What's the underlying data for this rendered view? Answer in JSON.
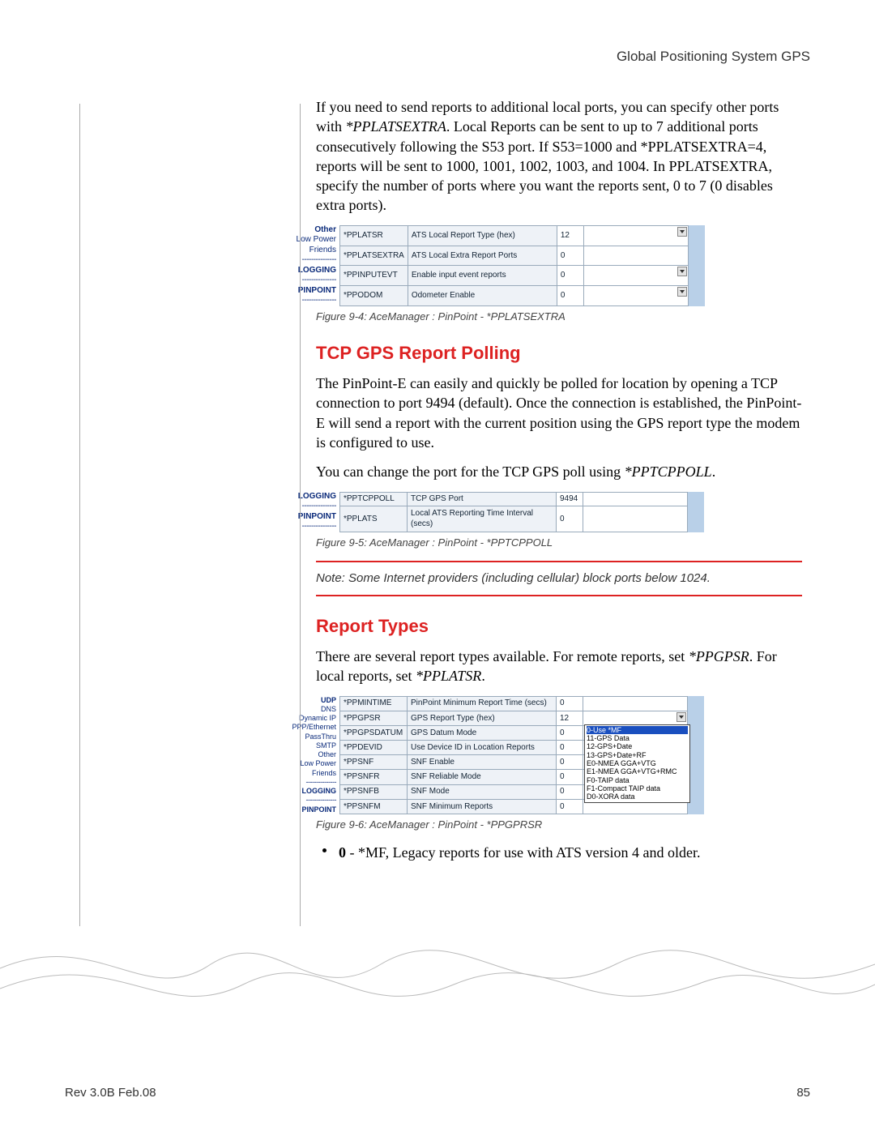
{
  "header": {
    "title": "Global Positioning System GPS"
  },
  "intro": {
    "p1_a": "If you need to send reports to additional local ports, you can specify other ports with ",
    "p1_cmd": "*PPLATSEXTRA",
    "p1_b": ". Local Reports can be sent to up to 7 additional ports consecutively following the S53 port.   If S53=1000 and *PPLATSEXTRA=4, reports will be sent to 1000, 1001, 1002, 1003, and 1004. In PPLATSEXTRA, specify the number of ports where you want the reports sent, 0 to 7 (0 disables extra ports)."
  },
  "fig1": {
    "sidebar": [
      "Other",
      "Low Power",
      "Friends",
      "---------------",
      "LOGGING",
      "---------------",
      "PINPOINT",
      "---------------"
    ],
    "sidebar_bold": {
      "0": true,
      "4": true,
      "6": true
    },
    "rows": [
      {
        "key": "*PPLATSR",
        "desc": "ATS Local Report Type (hex)",
        "val": "12",
        "dd": true
      },
      {
        "key": "*PPLATSEXTRA",
        "desc": "ATS Local Extra Report Ports",
        "val": "0",
        "dd": false
      },
      {
        "key": "*PPINPUTEVT",
        "desc": "Enable input event reports",
        "val": "0",
        "dd": true
      },
      {
        "key": "*PPODOM",
        "desc": "Odometer Enable",
        "val": "0",
        "dd": true
      }
    ],
    "caption": "Figure 9-4: AceManager : PinPoint - *PPLATSEXTRA"
  },
  "section1": {
    "title": "TCP GPS Report Polling",
    "p1": "The PinPoint-E can easily and quickly be polled for location by opening a TCP connection to port 9494 (default). Once the connection is established, the PinPoint-E will send a report with the current position using the GPS report type the modem is configured to use.",
    "p2_a": "You can change the port for the TCP GPS poll using ",
    "p2_cmd": "*PPTCPPOLL",
    "p2_b": "."
  },
  "fig2": {
    "sidebar": [
      "LOGGING",
      "---------------",
      "PINPOINT",
      "---------------"
    ],
    "sidebar_bold": {
      "0": true,
      "2": true
    },
    "rows": [
      {
        "key": "*PPTCPPOLL",
        "desc": "TCP GPS Port",
        "val": "9494",
        "dd": false
      },
      {
        "key": "*PPLATS",
        "desc": "Local ATS Reporting Time Interval (secs)",
        "val": "0",
        "dd": false
      }
    ],
    "caption": "Figure 9-5: AceManager : PinPoint - *PPTCPPOLL"
  },
  "note": "Note:  Some Internet providers (including cellular) block ports below 1024.",
  "section2": {
    "title": "Report Types",
    "p1_a": "There are several report types available. For remote reports, set ",
    "p1_cmd1": "*PPGPSR",
    "p1_b": ". For local reports, set ",
    "p1_cmd2": "*PPLATSR",
    "p1_c": "."
  },
  "fig3": {
    "sidebar": [
      "UDP",
      "DNS",
      "Dynamic IP",
      "PPP/Ethernet",
      "PassThru",
      "SMTP",
      "Other",
      "Low Power",
      "Friends",
      "---------------",
      "LOGGING",
      "---------------",
      "PINPOINT"
    ],
    "sidebar_bold": {
      "0": true,
      "10": true,
      "12": true
    },
    "rows": [
      {
        "key": "*PPMINTIME",
        "desc": "PinPoint Minimum Report Time (secs)",
        "val": "0",
        "dd": false
      },
      {
        "key": "*PPGPSR",
        "desc": "GPS Report Type (hex)",
        "val": "12",
        "dd": true,
        "popup": true
      },
      {
        "key": "*PPGPSDATUM",
        "desc": "GPS Datum Mode",
        "val": "0",
        "dd": false
      },
      {
        "key": "*PPDEVID",
        "desc": "Use Device ID in Location Reports",
        "val": "0",
        "dd": false
      },
      {
        "key": "*PPSNF",
        "desc": "SNF Enable",
        "val": "0",
        "dd": false
      },
      {
        "key": "*PPSNFR",
        "desc": "SNF Reliable Mode",
        "val": "0",
        "dd": false
      },
      {
        "key": "*PPSNFB",
        "desc": "SNF Mode",
        "val": "0",
        "dd": false
      },
      {
        "key": "*PPSNFM",
        "desc": "SNF Minimum Reports",
        "val": "0",
        "dd": false
      }
    ],
    "popup": [
      "0-Use *MF",
      "11-GPS Data",
      "12-GPS+Date",
      "13-GPS+Date+RF",
      "E0-NMEA GGA+VTG",
      "E1-NMEA GGA+VTG+RMC",
      "F0-TAIP data",
      "F1-Compact TAIP data",
      "D0-XORA data"
    ],
    "caption": "Figure 9-6: AceManager : PinPoint - *PPGPRSR"
  },
  "bullet1": {
    "b": "0",
    "text": " - *MF, Legacy reports for use with ATS version 4 and older."
  },
  "footer": {
    "left": "Rev 3.0B  Feb.08",
    "right": "85"
  }
}
